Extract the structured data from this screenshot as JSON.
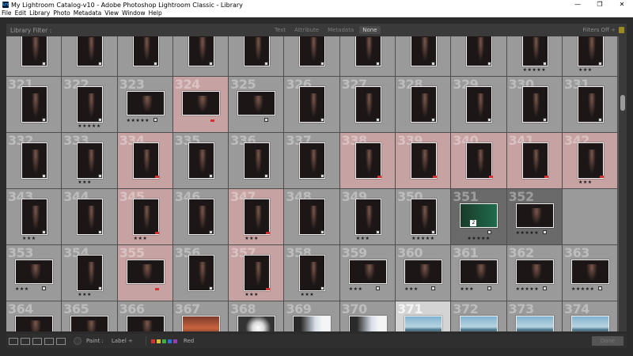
{
  "window": {
    "title": "My Lightroom Catalog-v10 - Adobe Photoshop Lightroom Classic - Library",
    "app_icon": "Lrc",
    "minimize": "—",
    "maximize": "❐",
    "close": "✕"
  },
  "menu": [
    "File",
    "Edit",
    "Library",
    "Photo",
    "Metadata",
    "View",
    "Window",
    "Help"
  ],
  "filter": {
    "label": "Library Filter :",
    "tabs": [
      "Text",
      "Attribute",
      "Metadata",
      "None"
    ],
    "active_tab": "None",
    "filters_off": "Filters Off ÷"
  },
  "grid": {
    "rows": [
      [
        "",
        "",
        "",
        "",
        "",
        "",
        "",
        "",
        "",
        "★★★★★",
        "★★★"
      ],
      [
        "321",
        "322",
        "323",
        "324",
        "325",
        "326",
        "327",
        "328",
        "329",
        "330",
        "331"
      ],
      [
        "332",
        "333",
        "334",
        "335",
        "336",
        "337",
        "338",
        "339",
        "340",
        "341",
        "342"
      ],
      [
        "343",
        "344",
        "345",
        "346",
        "347",
        "348",
        "349",
        "350",
        "351",
        "352",
        ""
      ],
      [
        "353",
        "354",
        "355",
        "356",
        "357",
        "358",
        "359",
        "360",
        "361",
        "362",
        "363"
      ],
      [
        "364",
        "365",
        "366",
        "367",
        "368",
        "369",
        "370",
        "371",
        "372",
        "373",
        "374"
      ]
    ]
  },
  "cells": [
    {
      "n": "",
      "s": "",
      "c": "",
      "t": "port"
    },
    {
      "n": "",
      "s": "",
      "c": "",
      "t": "port"
    },
    {
      "n": "",
      "s": "",
      "c": "",
      "t": "port"
    },
    {
      "n": "",
      "s": "",
      "c": "",
      "t": "port"
    },
    {
      "n": "",
      "s": "",
      "c": "",
      "t": "port"
    },
    {
      "n": "",
      "s": "",
      "c": "",
      "t": "port"
    },
    {
      "n": "",
      "s": "",
      "c": "",
      "t": "port"
    },
    {
      "n": "",
      "s": "",
      "c": "",
      "t": "port"
    },
    {
      "n": "",
      "s": "",
      "c": "",
      "t": "port"
    },
    {
      "n": "",
      "s": "★★★★★",
      "c": "",
      "t": "port"
    },
    {
      "n": "",
      "s": "★★★",
      "c": "",
      "t": "port"
    },
    {
      "n": "321",
      "s": "",
      "c": "",
      "t": "port"
    },
    {
      "n": "322",
      "s": "★★★★★",
      "c": "",
      "t": "port"
    },
    {
      "n": "323",
      "s": "★★★★★",
      "c": "",
      "t": "land"
    },
    {
      "n": "324",
      "s": "",
      "c": "red",
      "t": "land"
    },
    {
      "n": "325",
      "s": "",
      "c": "",
      "t": "land"
    },
    {
      "n": "326",
      "s": "",
      "c": "",
      "t": "port"
    },
    {
      "n": "327",
      "s": "",
      "c": "",
      "t": "port"
    },
    {
      "n": "328",
      "s": "",
      "c": "",
      "t": "port"
    },
    {
      "n": "329",
      "s": "",
      "c": "",
      "t": "port"
    },
    {
      "n": "330",
      "s": "",
      "c": "",
      "t": "port"
    },
    {
      "n": "331",
      "s": "",
      "c": "",
      "t": "port"
    },
    {
      "n": "332",
      "s": "",
      "c": "",
      "t": "port"
    },
    {
      "n": "333",
      "s": "★★★",
      "c": "",
      "t": "port"
    },
    {
      "n": "334",
      "s": "",
      "c": "red",
      "t": "port"
    },
    {
      "n": "335",
      "s": "",
      "c": "",
      "t": "port"
    },
    {
      "n": "336",
      "s": "",
      "c": "",
      "t": "port"
    },
    {
      "n": "337",
      "s": "",
      "c": "",
      "t": "port"
    },
    {
      "n": "338",
      "s": "",
      "c": "red",
      "t": "port"
    },
    {
      "n": "339",
      "s": "",
      "c": "red",
      "t": "port"
    },
    {
      "n": "340",
      "s": "",
      "c": "red",
      "t": "port"
    },
    {
      "n": "341",
      "s": "",
      "c": "red",
      "t": "port"
    },
    {
      "n": "342",
      "s": "★★★",
      "c": "red",
      "t": "port"
    },
    {
      "n": "343",
      "s": "★★★",
      "c": "",
      "t": "port"
    },
    {
      "n": "344",
      "s": "",
      "c": "",
      "t": "port"
    },
    {
      "n": "345",
      "s": "★★★",
      "c": "red",
      "t": "port"
    },
    {
      "n": "346",
      "s": "",
      "c": "",
      "t": "port"
    },
    {
      "n": "347",
      "s": "★★★",
      "c": "red",
      "t": "port"
    },
    {
      "n": "348",
      "s": "",
      "c": "",
      "t": "port"
    },
    {
      "n": "349",
      "s": "★★★",
      "c": "",
      "t": "port"
    },
    {
      "n": "350",
      "s": "★★★★★",
      "c": "",
      "t": "port"
    },
    {
      "n": "351",
      "s": "★★★★★",
      "c": "dark",
      "t": "green"
    },
    {
      "n": "352",
      "s": "★★★★★",
      "c": "dark",
      "t": "land"
    },
    {
      "n": "",
      "s": "",
      "c": "",
      "t": "none"
    },
    {
      "n": "353",
      "s": "★★★",
      "c": "",
      "t": "land"
    },
    {
      "n": "354",
      "s": "★★★",
      "c": "",
      "t": "port"
    },
    {
      "n": "355",
      "s": "",
      "c": "red",
      "t": "land"
    },
    {
      "n": "356",
      "s": "",
      "c": "",
      "t": "port"
    },
    {
      "n": "357",
      "s": "★★★",
      "c": "red",
      "t": "port"
    },
    {
      "n": "358",
      "s": "★★★",
      "c": "",
      "t": "port"
    },
    {
      "n": "359",
      "s": "★★★",
      "c": "",
      "t": "land"
    },
    {
      "n": "360",
      "s": "★★★",
      "c": "",
      "t": "land"
    },
    {
      "n": "361",
      "s": "★★★",
      "c": "",
      "t": "land"
    },
    {
      "n": "362",
      "s": "★★★★★",
      "c": "",
      "t": "land"
    },
    {
      "n": "363",
      "s": "★★★★★",
      "c": "",
      "t": "land"
    },
    {
      "n": "364",
      "s": "★★★★★",
      "c": "",
      "t": "land"
    },
    {
      "n": "365",
      "s": "",
      "c": "",
      "t": "land"
    },
    {
      "n": "366",
      "s": "★★★",
      "c": "",
      "t": "land"
    },
    {
      "n": "367",
      "s": "",
      "c": "",
      "t": "orange"
    },
    {
      "n": "368",
      "s": "",
      "c": "",
      "t": "lamp"
    },
    {
      "n": "369",
      "s": "★★★★★",
      "c": "",
      "t": "lit"
    },
    {
      "n": "370",
      "s": "★★★★★",
      "c": "",
      "t": "lit"
    },
    {
      "n": "371",
      "s": "★★★",
      "c": "selected",
      "t": "beach"
    },
    {
      "n": "372",
      "s": "",
      "c": "",
      "t": "beach"
    },
    {
      "n": "373",
      "s": "★★★",
      "c": "",
      "t": "beach"
    },
    {
      "n": "374",
      "s": "★★★",
      "c": "",
      "t": "beach"
    }
  ],
  "toolbar": {
    "paint_label": "Paint :",
    "paint_value": "Label ÷",
    "label_name": "Red",
    "done": "Done",
    "swatches": [
      "#d33030",
      "#d8c030",
      "#40b040",
      "#3070d0",
      "#9040b0"
    ]
  },
  "colors": {
    "red_label": "#c7a2a3",
    "grid_bg": "#9a9a9a",
    "selected": "#d4d4d4"
  }
}
